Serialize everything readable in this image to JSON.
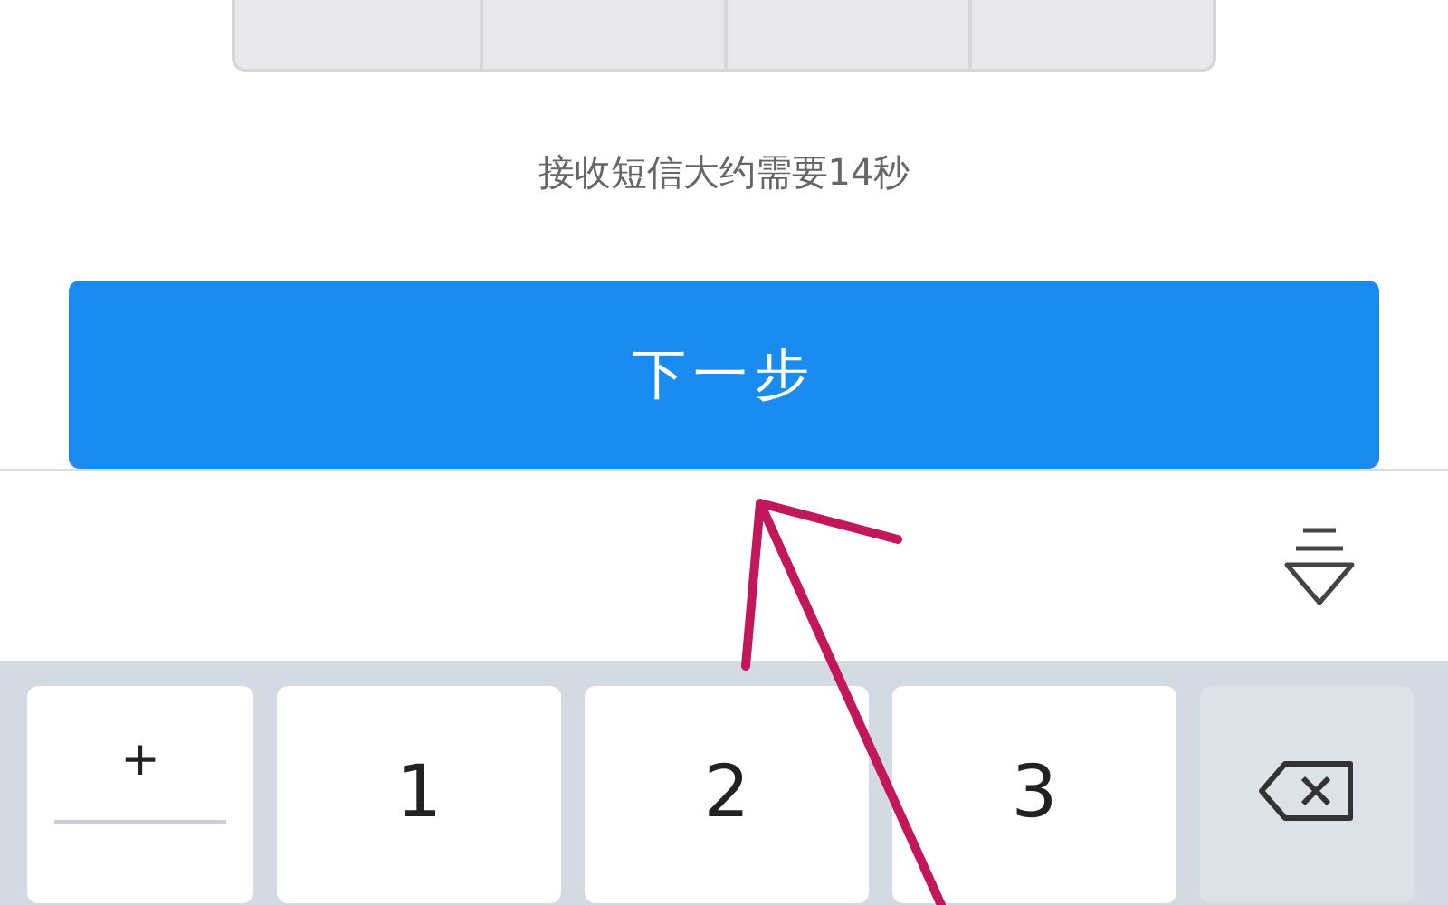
{
  "sms_hint": "接收短信大约需要14秒",
  "next_button": {
    "label": "下一步"
  },
  "keyboard": {
    "keys": [
      {
        "kind": "symbol",
        "label": "+"
      },
      {
        "kind": "digit",
        "label": "1"
      },
      {
        "kind": "digit",
        "label": "2"
      },
      {
        "kind": "digit",
        "label": "3"
      },
      {
        "kind": "backspace"
      }
    ]
  }
}
